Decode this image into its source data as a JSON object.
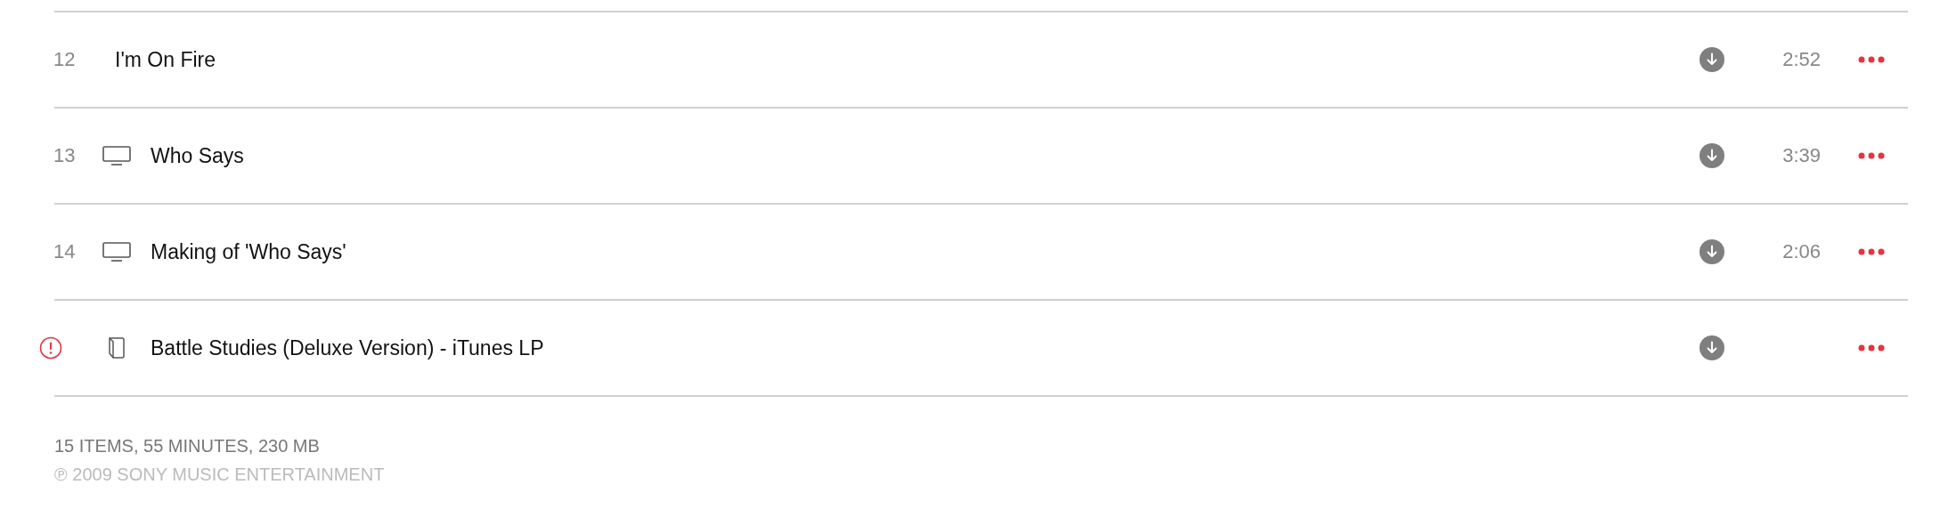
{
  "tracks": [
    {
      "number": "12",
      "kind": "song",
      "title": "I'm On Fire",
      "duration": "2:52",
      "alert": false
    },
    {
      "number": "13",
      "kind": "video",
      "title": "Who Says",
      "duration": "3:39",
      "alert": false
    },
    {
      "number": "14",
      "kind": "video",
      "title": "Making of 'Who Says'",
      "duration": "2:06",
      "alert": false
    },
    {
      "kind": "booklet",
      "title": "Battle Studies (Deluxe Version) - iTunes LP",
      "alert": true
    }
  ],
  "footer": {
    "summary": "15 ITEMS, 55 MINUTES, 230 MB",
    "copyright": "℗ 2009 SONY MUSIC ENTERTAINMENT"
  }
}
